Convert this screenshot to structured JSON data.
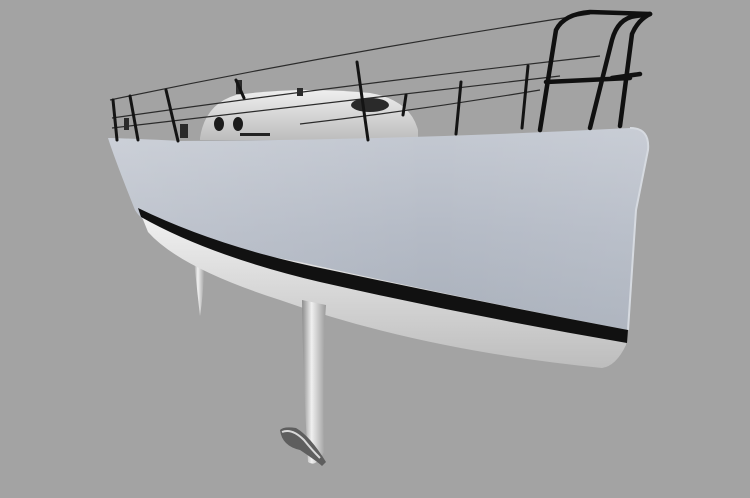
{
  "scene": {
    "background_color": "#a3a3a3",
    "hull_color": "#b9bfca",
    "bottom_color": "#e4e4e4",
    "stripe_color": "#111111",
    "deck_color": "#dcdcdc",
    "rail_color": "#111111",
    "icons": [
      "sailboat-hull-render"
    ]
  }
}
